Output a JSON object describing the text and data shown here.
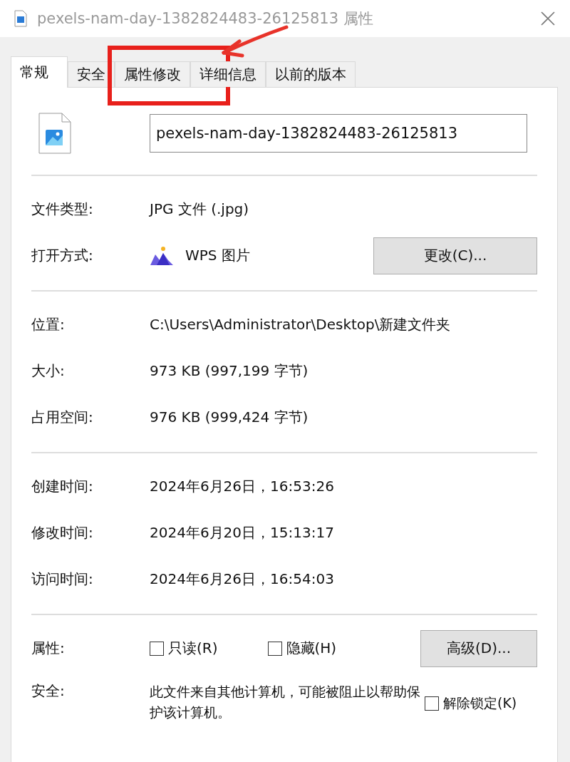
{
  "window": {
    "title": "pexels-nam-day-1382824483-26125813 属性"
  },
  "tabs": [
    {
      "label": "常规",
      "selected": true,
      "highlighted": false
    },
    {
      "label": "安全",
      "selected": false,
      "highlighted": false
    },
    {
      "label": "属性修改",
      "selected": false,
      "highlighted": true
    },
    {
      "label": "详细信息",
      "selected": false,
      "highlighted": false
    },
    {
      "label": "以前的版本",
      "selected": false,
      "highlighted": false
    }
  ],
  "file_name": {
    "value": "pexels-nam-day-1382824483-26125813"
  },
  "type_info": [
    {
      "label": "文件类型:",
      "value": "JPG 文件 (.jpg)"
    },
    {
      "label": "打开方式:",
      "value": "WPS 图片",
      "button": "更改(C)..."
    }
  ],
  "location_info": [
    {
      "label": "位置:",
      "value": "C:\\Users\\Administrator\\Desktop\\新建文件夹"
    },
    {
      "label": "大小:",
      "value": "973 KB (997,199 字节)"
    },
    {
      "label": "占用空间:",
      "value": "976 KB (999,424 字节)"
    }
  ],
  "time_info": [
    {
      "label": "创建时间:",
      "value": "2024年6月26日，16:53:26"
    },
    {
      "label": "修改时间:",
      "value": "2024年6月20日，15:13:17"
    },
    {
      "label": "访问时间:",
      "value": "2024年6月26日，16:54:03"
    }
  ],
  "attributes": {
    "label": "属性:",
    "checkboxes": [
      {
        "label": "只读(R)",
        "checked": false
      },
      {
        "label": "隐藏(H)",
        "checked": false
      }
    ],
    "button": "高级(D)..."
  },
  "security": {
    "label": "安全:",
    "text": "此文件来自其他计算机，可能被阻止以帮助保护该计算机。",
    "checkbox": {
      "label": "解除锁定(K)",
      "checked": false
    }
  }
}
